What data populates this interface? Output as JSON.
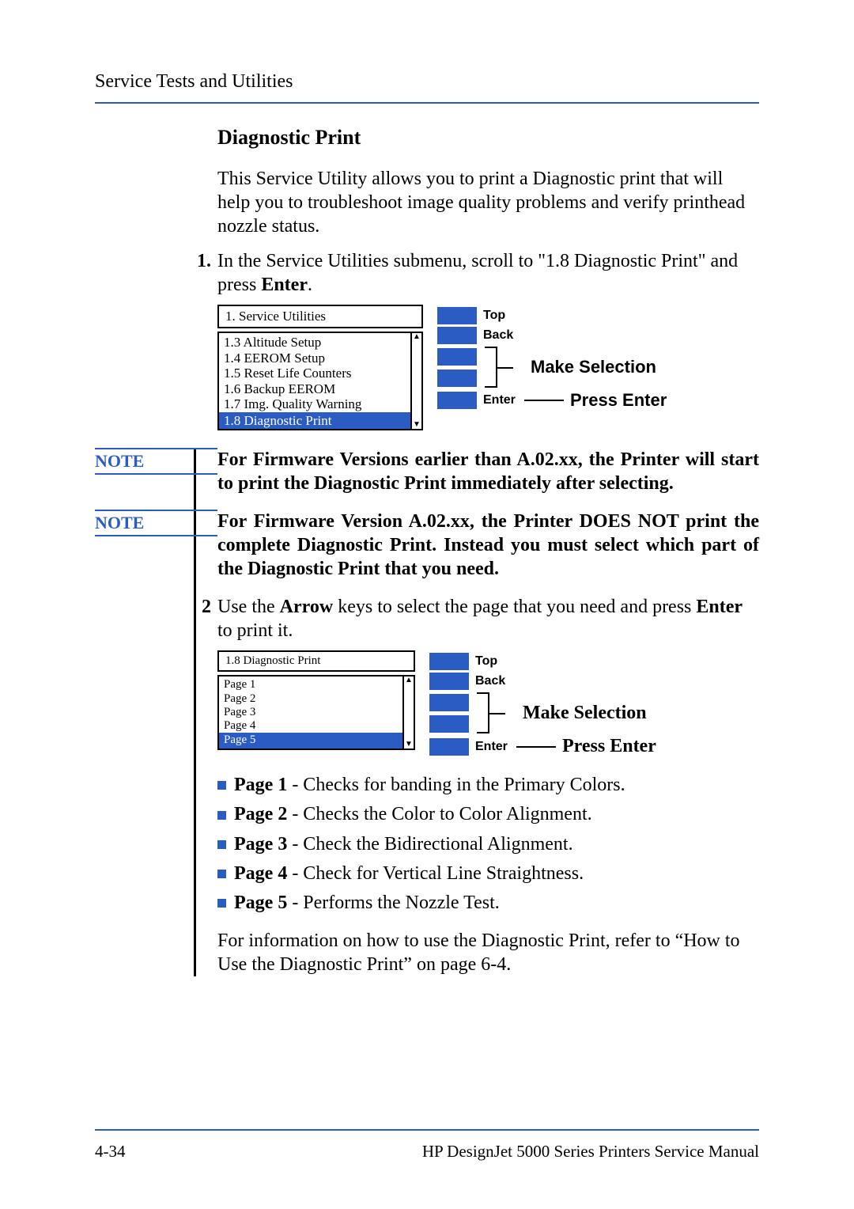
{
  "header": {
    "running": "Service Tests and Utilities"
  },
  "title": "Diagnostic Print",
  "intro": "This Service Utility allows you to print a Diagnostic print that will help you to troubleshoot image quality problems and verify printhead nozzle status.",
  "steps": {
    "s1_num": "1.",
    "s1_a": "In the Service Utilities submenu, scroll to \"1.8 Diagnostic Print\" and press ",
    "s1_b": "Enter",
    "s1_c": ".",
    "s2_num": "2",
    "s2_a": "Use the ",
    "s2_b": "Arrow",
    "s2_c": " keys to select the page that you need and press ",
    "s2_d": "Enter",
    "s2_e": " to print it."
  },
  "lcd1": {
    "header": "1. Service Utilities",
    "items": [
      "1.3 Altitude Setup",
      "1.4 EEROM Setup",
      "1.5 Reset Life Counters",
      "1.6 Backup EEROM",
      "1.7 Img. Quality Warning"
    ],
    "selected": "1.8 Diagnostic Print"
  },
  "lcd2": {
    "header": "1.8 Diagnostic Print",
    "items": [
      "Page 1",
      "Page 2",
      "Page 3",
      "Page 4"
    ],
    "selected": "Page 5"
  },
  "btns": {
    "top": "Top",
    "back": "Back",
    "enter": "Enter",
    "make_selection": "Make Selection",
    "press_enter": "Press Enter"
  },
  "notes": {
    "label": "NOTE",
    "n1": "For Firmware Versions earlier than A.02.xx, the Printer will start to print the Diagnostic Print immediately after selecting.",
    "n2": "For Firmware Version A.02.xx, the Printer DOES NOT print the complete Diagnostic Print. Instead you must select which part of the Diagnostic Print that you need."
  },
  "pages": {
    "p1b": "Page 1",
    "p1t": " - Checks for banding in the Primary Colors.",
    "p2b": "Page 2",
    "p2t": " - Checks the Color to Color Alignment.",
    "p3b": "Page 3",
    "p3t": " - Check the Bidirectional Alignment.",
    "p4b": "Page 4",
    "p4t": " - Check for Vertical Line Straightness.",
    "p5b": "Page 5",
    "p5t": " - Performs the Nozzle Test."
  },
  "xref": "For information on how to use the Diagnostic Print, refer to “How to Use the Diagnostic Print” on page 6-4.",
  "footer": {
    "left": "4-34",
    "right": "HP DesignJet 5000 Series Printers Service Manual"
  }
}
